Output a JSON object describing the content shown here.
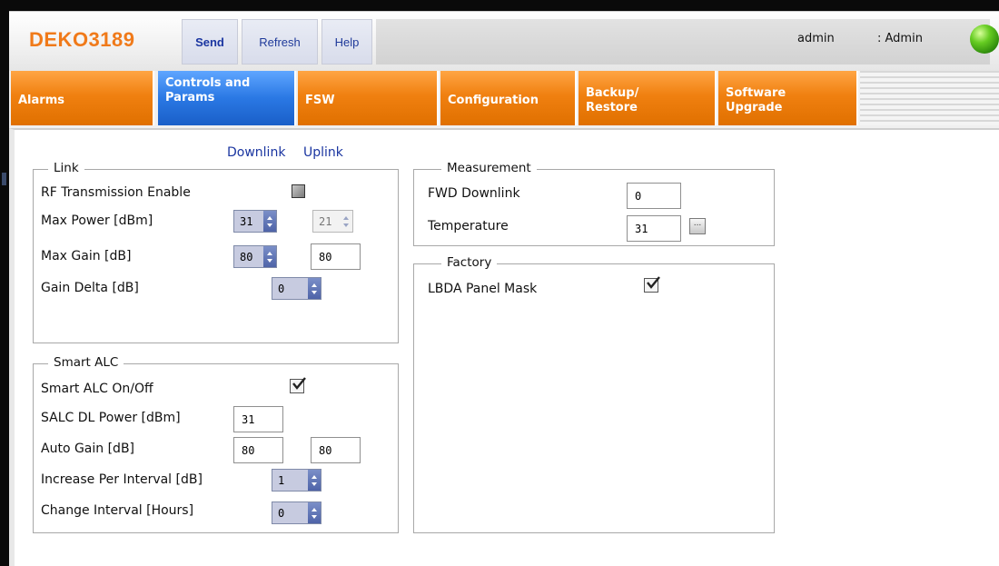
{
  "header": {
    "logo": "DEKO3189",
    "toolbar": {
      "send": "Send",
      "refresh": "Refresh",
      "help": "Help"
    },
    "user": "admin",
    "role": ": Admin",
    "status_color": "#55c01c"
  },
  "tabs": [
    {
      "line1": "Alarms",
      "line2": ""
    },
    {
      "line1": "Controls and",
      "line2": "Params"
    },
    {
      "line1": "FSW",
      "line2": ""
    },
    {
      "line1": "Configuration",
      "line2": ""
    },
    {
      "line1": "Backup/",
      "line2": "Restore"
    },
    {
      "line1": "Software",
      "line2": "Upgrade"
    }
  ],
  "active_tab": "Controls and Params",
  "subtabs": {
    "downlink": "Downlink",
    "uplink": "Uplink"
  },
  "link": {
    "title": "Link",
    "rf_enable": {
      "label": "RF Transmission Enable",
      "checked": false
    },
    "max_power": {
      "label": "Max Power [dBm]",
      "value": "31",
      "value2": "21"
    },
    "max_gain": {
      "label": "Max Gain [dB]",
      "value": "80",
      "value2": "80"
    },
    "gain_delta": {
      "label": "Gain Delta [dB]",
      "value": "0"
    }
  },
  "smart_alc": {
    "title": "Smart ALC",
    "onoff": {
      "label": "Smart ALC On/Off",
      "checked": true
    },
    "dl_power": {
      "label": "SALC DL Power [dBm]",
      "value": "31"
    },
    "auto_gain": {
      "label": "Auto Gain [dB]",
      "value": "80",
      "value2": "80"
    },
    "increase": {
      "label": "Increase Per Interval [dB]",
      "value": "1"
    },
    "interval": {
      "label": "Change Interval [Hours]",
      "value": "0"
    }
  },
  "measurement": {
    "title": "Measurement",
    "fwd_downlink": {
      "label": "FWD Downlink",
      "value": "0"
    },
    "temperature": {
      "label": "Temperature",
      "value": "31",
      "button": "..."
    }
  },
  "factory": {
    "title": "Factory",
    "lbda": {
      "label": "LBDA Panel Mask",
      "checked": true
    }
  },
  "colors": {
    "tab_orange": "#f08010",
    "tab_active_blue": "#2a78e4",
    "logo_orange": "#f07a1a",
    "link_blue": "#1a35a0"
  }
}
